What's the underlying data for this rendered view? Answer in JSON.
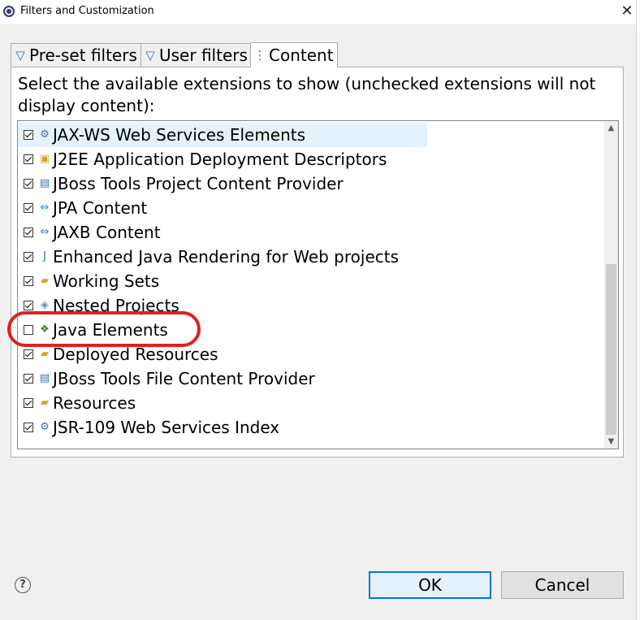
{
  "window": {
    "title": "Filters and Customization",
    "close_glyph": "✕"
  },
  "tabs": [
    {
      "label": "Pre-set filters",
      "icon": "filter-icon",
      "active": false
    },
    {
      "label": "User filters",
      "icon": "filter-icon",
      "active": false
    },
    {
      "label": "Content",
      "icon": "content-tree-icon",
      "active": true
    }
  ],
  "description": "Select the available extensions to show (unchecked extensions will not display content):",
  "extensions": [
    {
      "label": "JAX-WS Web Services Elements",
      "checked": true,
      "icon": "web-service-icon"
    },
    {
      "label": "J2EE Application Deployment Descriptors",
      "checked": true,
      "icon": "folder-descriptor-icon"
    },
    {
      "label": "JBoss Tools Project Content Provider",
      "checked": true,
      "icon": "jboss-web-icon"
    },
    {
      "label": "JPA Content",
      "checked": true,
      "icon": "jpa-icon"
    },
    {
      "label": "JAXB Content",
      "checked": true,
      "icon": "jaxb-icon"
    },
    {
      "label": "Enhanced Java Rendering for Web projects",
      "checked": true,
      "icon": "java-file-icon"
    },
    {
      "label": "Working Sets",
      "checked": true,
      "icon": "working-set-icon"
    },
    {
      "label": "Nested Projects",
      "checked": true,
      "icon": "nested-projects-icon"
    },
    {
      "label": "Java Elements",
      "checked": false,
      "icon": "java-elements-icon"
    },
    {
      "label": "Deployed Resources",
      "checked": true,
      "icon": "deployed-resources-icon"
    },
    {
      "label": "JBoss Tools File Content Provider",
      "checked": true,
      "icon": "jboss-web-icon"
    },
    {
      "label": "Resources",
      "checked": true,
      "icon": "resources-folder-icon"
    },
    {
      "label": "JSR-109 Web Services Index",
      "checked": true,
      "icon": "web-service-icon"
    }
  ],
  "buttons": {
    "ok": "OK",
    "cancel": "Cancel",
    "help": "?"
  },
  "scroll": {
    "up": "▲",
    "down": "▼"
  },
  "colors": {
    "accent": "#0078d7",
    "annotation": "#e0201e",
    "highlight_row": "#e5f1fb"
  }
}
